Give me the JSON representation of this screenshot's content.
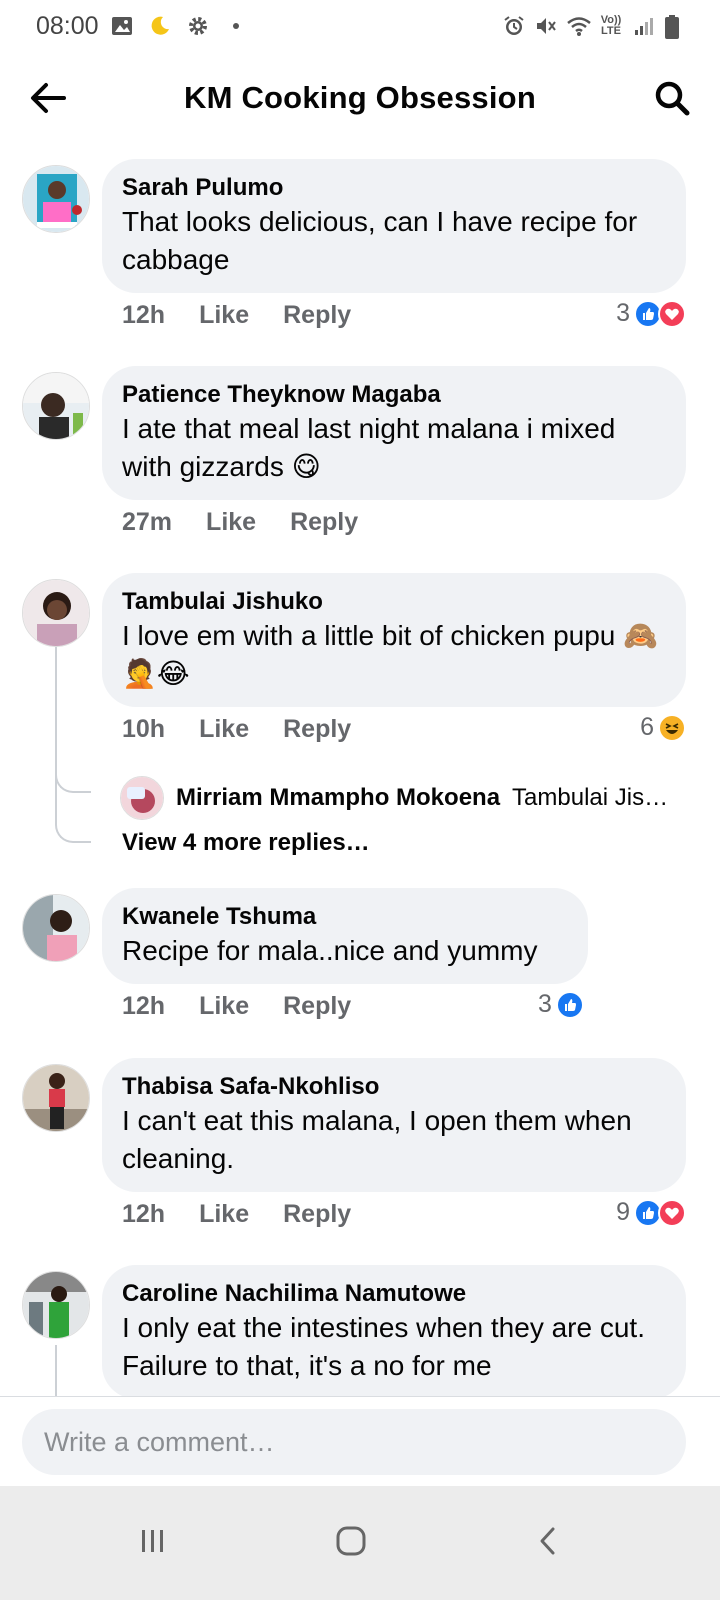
{
  "status_bar": {
    "time": "08:00",
    "left_icons": [
      "image-icon",
      "moon-icon",
      "gear-icon",
      "dot-icon"
    ],
    "right_icons": [
      "alarm-icon",
      "mute-icon",
      "wifi-icon",
      "volte-icon",
      "signal-icon",
      "battery-icon"
    ],
    "volte_text": "Vo)) LTE"
  },
  "header": {
    "title": "KM Cooking Obsession"
  },
  "comments": [
    {
      "author": "Sarah Pulumo",
      "text": "That looks delicious, can I have recipe for cabbage",
      "time": "12h",
      "like": "Like",
      "reply": "Reply",
      "reaction_count": "3",
      "reactions": [
        "like",
        "love"
      ]
    },
    {
      "author": "Patience Theyknow Magaba",
      "text": "I ate that meal last night malana i mixed with gizzards 😋",
      "time": "27m",
      "like": "Like",
      "reply": "Reply"
    },
    {
      "author": "Tambulai Jishuko",
      "text": "I love em with a little bit of chicken pupu 🙈🤦😂",
      "time": "10h",
      "like": "Like",
      "reply": "Reply",
      "reaction_count": "6",
      "reactions": [
        "haha"
      ],
      "reply_preview": {
        "author": "Mirriam Mmampho Mokoena",
        "snippet": "Tambulai Jis…"
      },
      "view_more": "View 4 more replies…"
    },
    {
      "author": "Kwanele Tshuma",
      "text": "Recipe for mala..nice and yummy",
      "time": "12h",
      "like": "Like",
      "reply": "Reply",
      "reaction_count": "3",
      "reactions": [
        "like"
      ]
    },
    {
      "author": "Thabisa Safa-Nkohliso",
      "text": "I can't eat this malana, I open them when cleaning.",
      "time": "12h",
      "like": "Like",
      "reply": "Reply",
      "reaction_count": "9",
      "reactions": [
        "like",
        "love"
      ]
    },
    {
      "author": "Caroline Nachilima Namutowe",
      "text": "I only eat the intestines when they are cut. Failure to that, it's a no for me"
    }
  ],
  "composer": {
    "placeholder": "Write a comment…"
  },
  "navbar": {
    "buttons": [
      "recent-apps-icon",
      "home-icon",
      "back-icon"
    ]
  },
  "colors": {
    "bubble": "#f0f2f5",
    "like": "#1877f2",
    "love": "#f33e58",
    "haha": "#f7b125",
    "meta": "#65676b"
  }
}
